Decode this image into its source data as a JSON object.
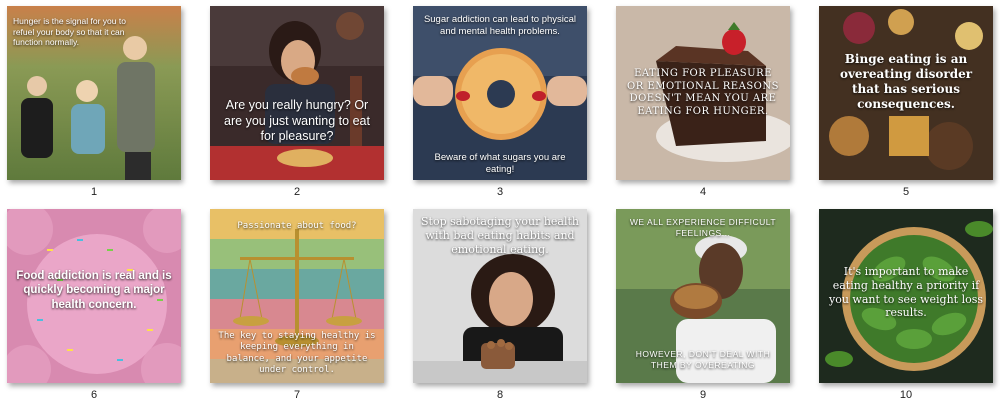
{
  "thumbnails": [
    {
      "number": "1",
      "caption": "Hunger is the signal for you to refuel your body so that it can function normally."
    },
    {
      "number": "2",
      "caption": "Are you really hungry? Or are you just wanting to eat for pleasure?"
    },
    {
      "number": "3",
      "caption": "Sugar addiction can lead to physical and mental health problems.",
      "caption2": "Beware of what sugars you are eating!"
    },
    {
      "number": "4",
      "caption": "EATING FOR PLEASURE OR EMOTIONAL REASONS DOESN'T MEAN YOU ARE EATING FOR HUNGER."
    },
    {
      "number": "5",
      "caption": "Binge eating is an overeating disorder that has serious consequences."
    },
    {
      "number": "6",
      "caption": "Food addiction is real and is quickly becoming a major health concern."
    },
    {
      "number": "7",
      "caption": "Passionate about food?",
      "caption2": "The key to staying healthy is keeping everything in balance, and your appetite under control."
    },
    {
      "number": "8",
      "caption": "Stop sabotaging your health with bad eating habits and emotional eating."
    },
    {
      "number": "9",
      "caption": "WE ALL EXPERIENCE DIFFICULT FEELINGS...",
      "caption2": "HOWEVER, DON'T DEAL WITH THEM BY OVEREATING"
    },
    {
      "number": "10",
      "caption": "It's important to make eating healthy a priority if you want to see weight loss results."
    }
  ]
}
